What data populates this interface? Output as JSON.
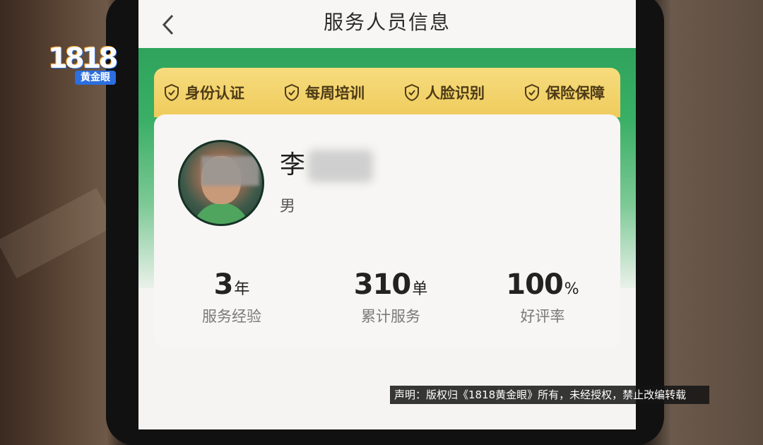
{
  "header": {
    "title": "服务人员信息",
    "back_glyph": "‹"
  },
  "badges": [
    {
      "label": "身份认证",
      "icon": "shield-check-icon"
    },
    {
      "label": "每周培训",
      "icon": "shield-check-icon"
    },
    {
      "label": "人脸识别",
      "icon": "shield-check-icon"
    },
    {
      "label": "保险保障",
      "icon": "shield-check-icon"
    }
  ],
  "profile": {
    "name_visible": "李",
    "gender": "男"
  },
  "stats": [
    {
      "value": "3",
      "unit": "年",
      "label": "服务经验"
    },
    {
      "value": "310",
      "unit": "单",
      "label": "累计服务"
    },
    {
      "value": "100",
      "unit": "%",
      "label": "好评率"
    }
  ],
  "watermark": {
    "logo_number": "1818",
    "logo_text": "黄金眼"
  },
  "disclaimer": "声明：版权归《1818黄金眼》所有，未经授权，禁止改编转载",
  "colors": {
    "green": "#2fa35b",
    "gold": "#efcb5c",
    "logo_blue": "#2b6fe0"
  }
}
